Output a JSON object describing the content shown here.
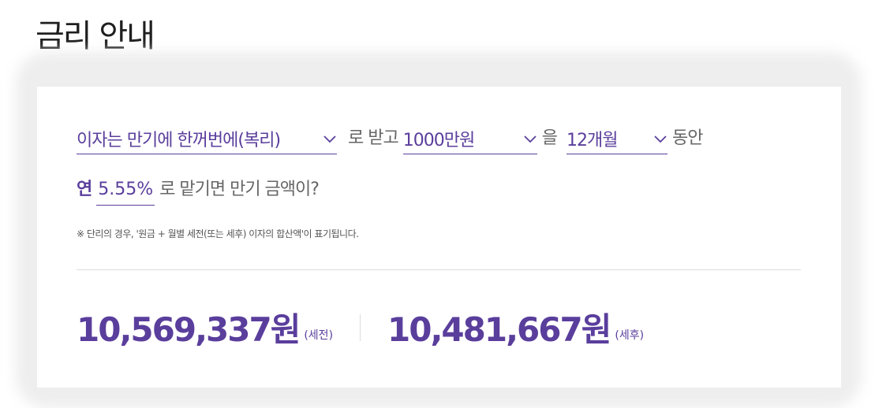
{
  "page": {
    "title": "금리 안내"
  },
  "calculator": {
    "interest_type": "이자는 만기에 한꺼번에(복리)",
    "text_receive": "로 받고",
    "amount": "1000만원",
    "text_eul": "을",
    "period": "12개월",
    "text_during": "동안",
    "text_year": "연",
    "rate": "5.55%",
    "text_question": "로 맡기면 만기 금액이?",
    "note": "※  단리의 경우, '원금 + 월별 세전(또는 세후) 이자의 합산액'이 표기됩니다."
  },
  "results": {
    "pre_tax_amount": "10,569,337원",
    "pre_tax_label": "(세전)",
    "post_tax_amount": "10,481,667원",
    "post_tax_label": "(세후)"
  },
  "icons": {
    "dropdown": "chevron-down-icon"
  },
  "colors": {
    "accent": "#5a3e9c",
    "text": "#666666",
    "title": "#1f1f1f"
  }
}
